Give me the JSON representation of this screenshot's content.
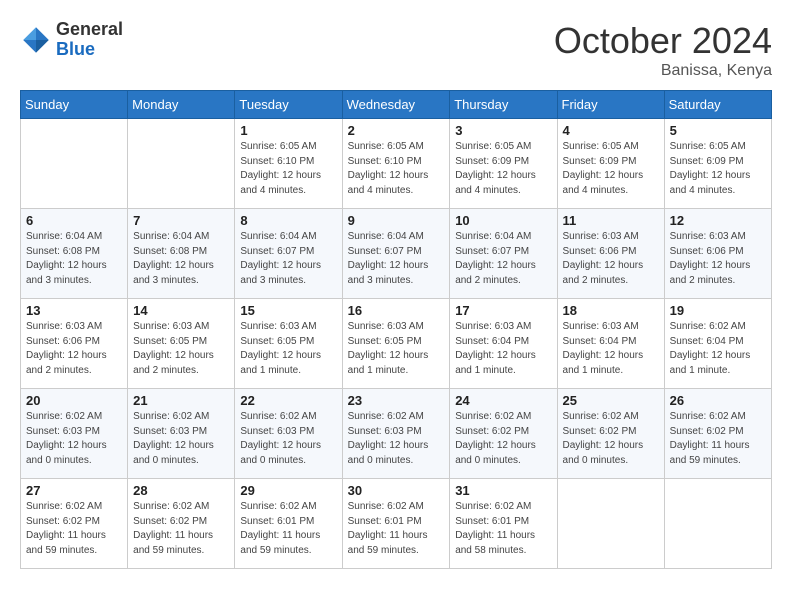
{
  "header": {
    "logo_line1": "General",
    "logo_line2": "Blue",
    "month": "October 2024",
    "location": "Banissa, Kenya"
  },
  "days_of_week": [
    "Sunday",
    "Monday",
    "Tuesday",
    "Wednesday",
    "Thursday",
    "Friday",
    "Saturday"
  ],
  "weeks": [
    [
      {
        "day": "",
        "detail": ""
      },
      {
        "day": "",
        "detail": ""
      },
      {
        "day": "1",
        "detail": "Sunrise: 6:05 AM\nSunset: 6:10 PM\nDaylight: 12 hours and 4 minutes."
      },
      {
        "day": "2",
        "detail": "Sunrise: 6:05 AM\nSunset: 6:10 PM\nDaylight: 12 hours and 4 minutes."
      },
      {
        "day": "3",
        "detail": "Sunrise: 6:05 AM\nSunset: 6:09 PM\nDaylight: 12 hours and 4 minutes."
      },
      {
        "day": "4",
        "detail": "Sunrise: 6:05 AM\nSunset: 6:09 PM\nDaylight: 12 hours and 4 minutes."
      },
      {
        "day": "5",
        "detail": "Sunrise: 6:05 AM\nSunset: 6:09 PM\nDaylight: 12 hours and 4 minutes."
      }
    ],
    [
      {
        "day": "6",
        "detail": "Sunrise: 6:04 AM\nSunset: 6:08 PM\nDaylight: 12 hours and 3 minutes."
      },
      {
        "day": "7",
        "detail": "Sunrise: 6:04 AM\nSunset: 6:08 PM\nDaylight: 12 hours and 3 minutes."
      },
      {
        "day": "8",
        "detail": "Sunrise: 6:04 AM\nSunset: 6:07 PM\nDaylight: 12 hours and 3 minutes."
      },
      {
        "day": "9",
        "detail": "Sunrise: 6:04 AM\nSunset: 6:07 PM\nDaylight: 12 hours and 3 minutes."
      },
      {
        "day": "10",
        "detail": "Sunrise: 6:04 AM\nSunset: 6:07 PM\nDaylight: 12 hours and 2 minutes."
      },
      {
        "day": "11",
        "detail": "Sunrise: 6:03 AM\nSunset: 6:06 PM\nDaylight: 12 hours and 2 minutes."
      },
      {
        "day": "12",
        "detail": "Sunrise: 6:03 AM\nSunset: 6:06 PM\nDaylight: 12 hours and 2 minutes."
      }
    ],
    [
      {
        "day": "13",
        "detail": "Sunrise: 6:03 AM\nSunset: 6:06 PM\nDaylight: 12 hours and 2 minutes."
      },
      {
        "day": "14",
        "detail": "Sunrise: 6:03 AM\nSunset: 6:05 PM\nDaylight: 12 hours and 2 minutes."
      },
      {
        "day": "15",
        "detail": "Sunrise: 6:03 AM\nSunset: 6:05 PM\nDaylight: 12 hours and 1 minute."
      },
      {
        "day": "16",
        "detail": "Sunrise: 6:03 AM\nSunset: 6:05 PM\nDaylight: 12 hours and 1 minute."
      },
      {
        "day": "17",
        "detail": "Sunrise: 6:03 AM\nSunset: 6:04 PM\nDaylight: 12 hours and 1 minute."
      },
      {
        "day": "18",
        "detail": "Sunrise: 6:03 AM\nSunset: 6:04 PM\nDaylight: 12 hours and 1 minute."
      },
      {
        "day": "19",
        "detail": "Sunrise: 6:02 AM\nSunset: 6:04 PM\nDaylight: 12 hours and 1 minute."
      }
    ],
    [
      {
        "day": "20",
        "detail": "Sunrise: 6:02 AM\nSunset: 6:03 PM\nDaylight: 12 hours and 0 minutes."
      },
      {
        "day": "21",
        "detail": "Sunrise: 6:02 AM\nSunset: 6:03 PM\nDaylight: 12 hours and 0 minutes."
      },
      {
        "day": "22",
        "detail": "Sunrise: 6:02 AM\nSunset: 6:03 PM\nDaylight: 12 hours and 0 minutes."
      },
      {
        "day": "23",
        "detail": "Sunrise: 6:02 AM\nSunset: 6:03 PM\nDaylight: 12 hours and 0 minutes."
      },
      {
        "day": "24",
        "detail": "Sunrise: 6:02 AM\nSunset: 6:02 PM\nDaylight: 12 hours and 0 minutes."
      },
      {
        "day": "25",
        "detail": "Sunrise: 6:02 AM\nSunset: 6:02 PM\nDaylight: 12 hours and 0 minutes."
      },
      {
        "day": "26",
        "detail": "Sunrise: 6:02 AM\nSunset: 6:02 PM\nDaylight: 11 hours and 59 minutes."
      }
    ],
    [
      {
        "day": "27",
        "detail": "Sunrise: 6:02 AM\nSunset: 6:02 PM\nDaylight: 11 hours and 59 minutes."
      },
      {
        "day": "28",
        "detail": "Sunrise: 6:02 AM\nSunset: 6:02 PM\nDaylight: 11 hours and 59 minutes."
      },
      {
        "day": "29",
        "detail": "Sunrise: 6:02 AM\nSunset: 6:01 PM\nDaylight: 11 hours and 59 minutes."
      },
      {
        "day": "30",
        "detail": "Sunrise: 6:02 AM\nSunset: 6:01 PM\nDaylight: 11 hours and 59 minutes."
      },
      {
        "day": "31",
        "detail": "Sunrise: 6:02 AM\nSunset: 6:01 PM\nDaylight: 11 hours and 58 minutes."
      },
      {
        "day": "",
        "detail": ""
      },
      {
        "day": "",
        "detail": ""
      }
    ]
  ]
}
